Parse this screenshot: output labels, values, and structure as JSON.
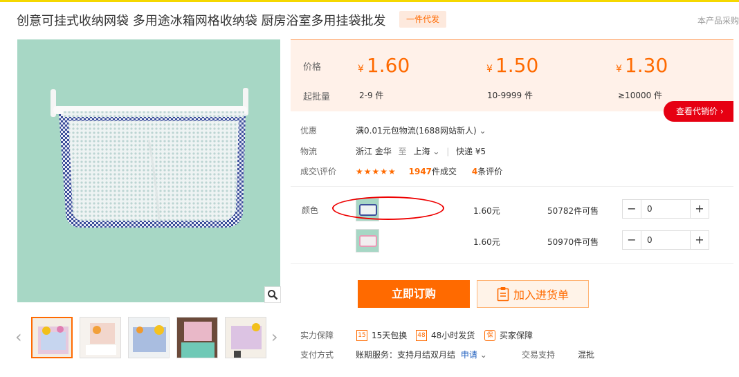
{
  "header": {
    "title": "创意可挂式收纳网袋 多用途冰箱网格收纳袋 厨房浴室多用挂袋批发",
    "badge": "一件代发",
    "top_right": "本产品采购"
  },
  "price_box": {
    "price_label": "价格",
    "qty_label": "起批量",
    "tiers": [
      {
        "currency": "¥",
        "price": "1.60",
        "qty": "2-9 件"
      },
      {
        "currency": "¥",
        "price": "1.50",
        "qty": "10-9999 件"
      },
      {
        "currency": "¥",
        "price": "1.30",
        "qty": "≥10000 件"
      }
    ],
    "agent_button": "查看代销价 ›"
  },
  "info": {
    "discount_label": "优惠",
    "discount_value": "满0.01元包物流(1688网站新人)",
    "logistics_label": "物流",
    "from": "浙江 金华",
    "to_word": "至",
    "to": "上海",
    "express": "快递 ¥5",
    "deal_label": "成交\\评价",
    "stars": "★★★★★",
    "deal_count": "1947",
    "deal_suffix": "件成交",
    "review_count": "4",
    "review_suffix": "条评价"
  },
  "sku": {
    "label": "颜色",
    "rows": [
      {
        "price": "1.60元",
        "stock": "50782件可售",
        "qty": "0"
      },
      {
        "price": "1.60元",
        "stock": "50970件可售",
        "qty": "0"
      }
    ]
  },
  "actions": {
    "buy": "立即订购",
    "cart": "加入进货单"
  },
  "guarantee": {
    "label": "实力保障",
    "items": [
      {
        "icon": "15",
        "text": "15天包换"
      },
      {
        "icon": "48",
        "text": "48小时发货"
      },
      {
        "icon": "保",
        "text": "买家保障"
      }
    ]
  },
  "payment": {
    "label": "支付方式",
    "value": "账期服务：支持月结双月结",
    "apply": "申请",
    "trade_label": "交易支持",
    "trade_value": "混批"
  },
  "colors": {
    "accent": "#ff6a00",
    "red": "#e60012",
    "price_bg": "#fff1e9"
  }
}
